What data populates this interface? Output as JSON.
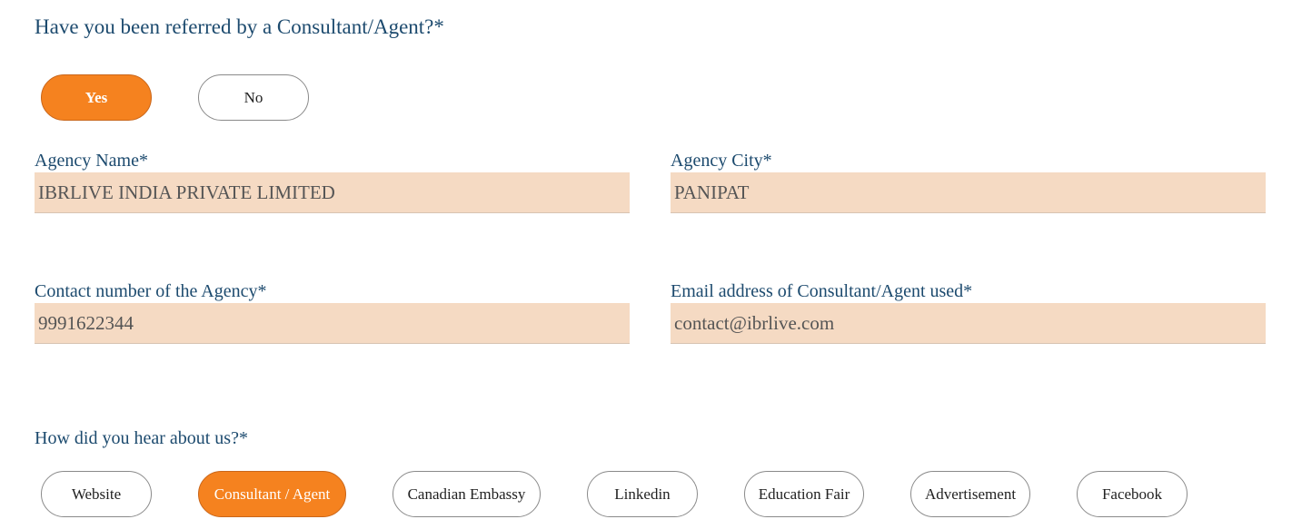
{
  "referral": {
    "question": "Have you been referred by a Consultant/Agent?*",
    "options": [
      {
        "label": "Yes",
        "selected": true
      },
      {
        "label": "No",
        "selected": false
      }
    ]
  },
  "fields": {
    "agency_name": {
      "label": "Agency Name*",
      "value": "IBRLIVE INDIA PRIVATE LIMITED"
    },
    "agency_city": {
      "label": "Agency City*",
      "value": "PANIPAT"
    },
    "contact_number": {
      "label": "Contact number of the Agency*",
      "value": "9991622344"
    },
    "email": {
      "label": "Email address of Consultant/Agent used*",
      "value": "contact@ibrlive.com"
    }
  },
  "hear_about": {
    "question": "How did you hear about us?*",
    "options": [
      {
        "label": "Website",
        "selected": false
      },
      {
        "label": "Consultant / Agent",
        "selected": true
      },
      {
        "label": "Canadian Embassy",
        "selected": false
      },
      {
        "label": "Linkedin",
        "selected": false
      },
      {
        "label": "Education Fair",
        "selected": false
      },
      {
        "label": "Advertisement",
        "selected": false
      },
      {
        "label": "Facebook",
        "selected": false
      }
    ]
  },
  "colors": {
    "accent": "#f5821f",
    "label_text": "#1c4a6e",
    "field_background": "#f5dac3"
  }
}
